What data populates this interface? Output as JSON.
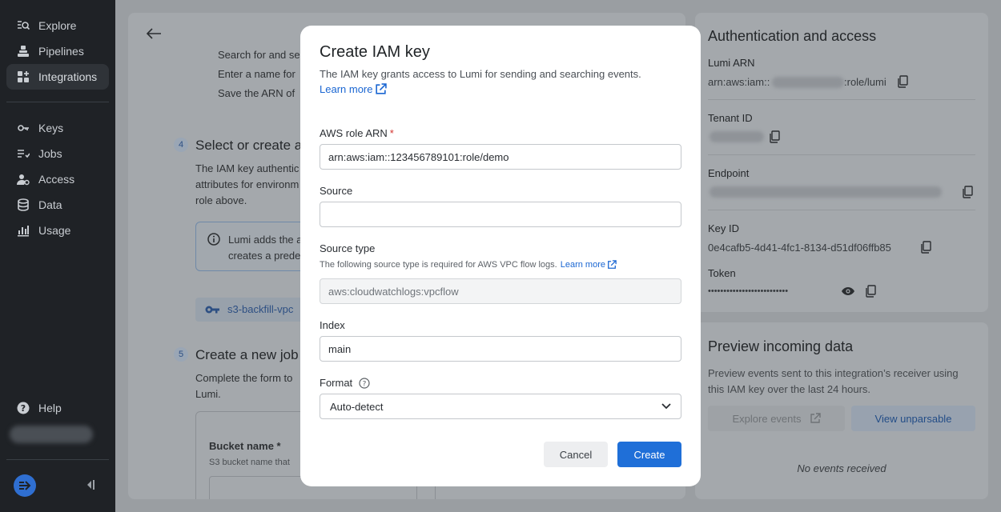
{
  "sidebar": {
    "items": [
      {
        "label": "Explore",
        "icon": "explore-icon"
      },
      {
        "label": "Pipelines",
        "icon": "pipelines-icon"
      },
      {
        "label": "Integrations",
        "icon": "integrations-icon",
        "active": true
      },
      {
        "label": "Keys",
        "icon": "key-icon"
      },
      {
        "label": "Jobs",
        "icon": "jobs-icon"
      },
      {
        "label": "Access",
        "icon": "access-icon"
      },
      {
        "label": "Data",
        "icon": "database-icon"
      },
      {
        "label": "Usage",
        "icon": "usage-icon"
      }
    ],
    "help": "Help"
  },
  "background": {
    "step_text_1": "Search for and se",
    "step_text_2": "Enter a name for",
    "step_text_3": "Save the ARN of",
    "step4_number": "4",
    "step4_title": "Select or create a",
    "step4_desc_1": "The IAM key authentic",
    "step4_desc_2": "attributes for environm",
    "step4_desc_3": "role above.",
    "info_line_1": "Lumi adds the a",
    "info_line_2": "creates a prede",
    "chip_label": "s3-backfill-vpc",
    "step5_number": "5",
    "step5_title": "Create a new job",
    "step5_desc_1": "Complete the form to",
    "step5_desc_2": "Lumi.",
    "bucket_label": "Bucket name *",
    "bucket_help": "S3 bucket name that"
  },
  "auth": {
    "title": "Authentication and access",
    "lumi_arn_label": "Lumi ARN",
    "lumi_arn_prefix": "arn:aws:iam::",
    "lumi_arn_suffix": ":role/lumi",
    "tenant_id_label": "Tenant ID",
    "endpoint_label": "Endpoint",
    "key_id_label": "Key ID",
    "key_id_value": "0e4cafb5-4d41-4fc1-8134-d51df06ffb85",
    "token_label": "Token",
    "token_value": "••••••••••••••••••••••••••"
  },
  "preview": {
    "title": "Preview incoming data",
    "desc_1": "Preview events sent to this integration’s receiver using",
    "desc_2": "this IAM key over the last 24 hours.",
    "explore_btn": "Explore events",
    "unparsable_btn": "View unparsable",
    "empty": "No events received"
  },
  "modal": {
    "title": "Create IAM key",
    "description": "The IAM key grants access to Lumi for sending and searching events.",
    "learn_more": "Learn more",
    "role_arn_label": "AWS role ARN",
    "required_mark": "*",
    "role_arn_value": "arn:aws:iam::123456789101:role/demo",
    "source_label": "Source",
    "source_value": "",
    "source_type_label": "Source type",
    "source_type_help": "The following source type is required for AWS VPC flow logs.",
    "source_type_link": "Learn more",
    "source_type_value": "aws:cloudwatchlogs:vpcflow",
    "index_label": "Index",
    "index_value": "main",
    "format_label": "Format",
    "format_value": "Auto-detect",
    "cancel": "Cancel",
    "create": "Create"
  }
}
